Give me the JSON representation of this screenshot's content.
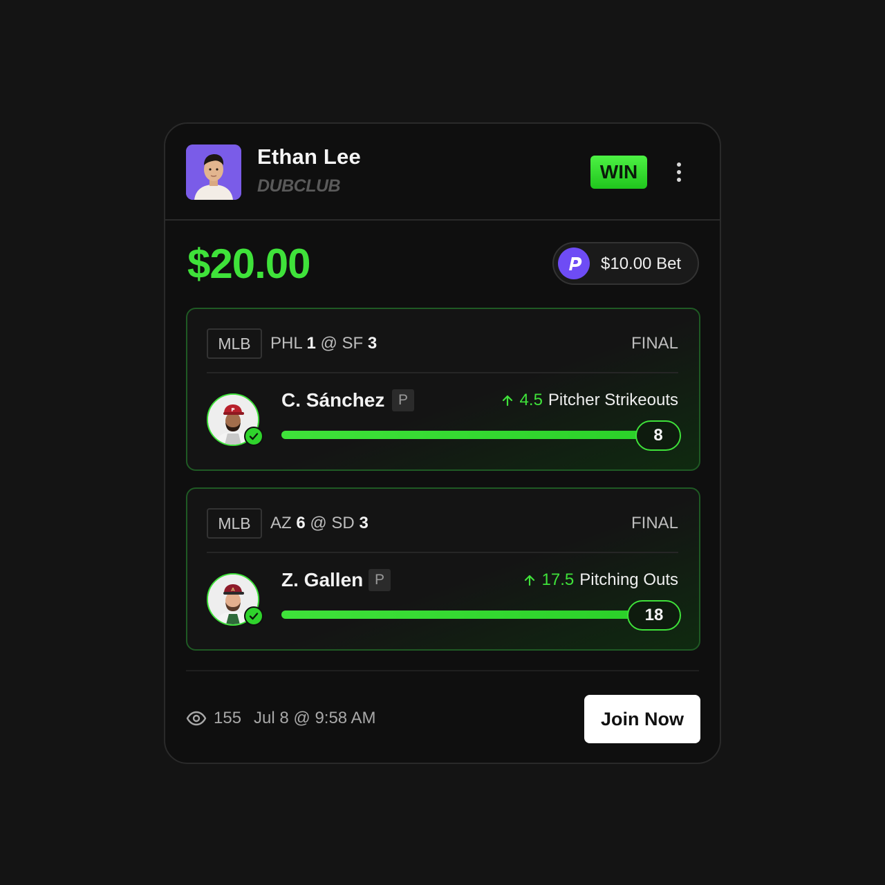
{
  "header": {
    "user_name": "Ethan Lee",
    "club": "DUBCLUB",
    "result_badge": "WIN",
    "more_icon": "more-vertical-icon"
  },
  "summary": {
    "payout": "$20.00",
    "bet_amount": "$10.00 Bet",
    "sportsbook_icon": "prizepicks-logo-icon"
  },
  "legs": [
    {
      "league": "MLB",
      "away_team": "PHL",
      "away_score": "1",
      "at": "@",
      "home_team": "SF",
      "home_score": "3",
      "status": "FINAL",
      "player": "C. Sánchez",
      "position": "P",
      "direction_icon": "arrow-up-icon",
      "line": "4.5",
      "stat": "Pitcher Strikeouts",
      "result": "8",
      "hit": true
    },
    {
      "league": "MLB",
      "away_team": "AZ",
      "away_score": "6",
      "at": "@",
      "home_team": "SD",
      "home_score": "3",
      "status": "FINAL",
      "player": "Z. Gallen",
      "position": "P",
      "direction_icon": "arrow-up-icon",
      "line": "17.5",
      "stat": "Pitching Outs",
      "result": "18",
      "hit": true
    }
  ],
  "footer": {
    "views": "155",
    "timestamp": "Jul 8 @ 9:58 AM",
    "join_label": "Join Now"
  },
  "colors": {
    "accent_green": "#3fe23a",
    "brand_purple": "#6e4cf5",
    "background": "#0f0f0f"
  }
}
